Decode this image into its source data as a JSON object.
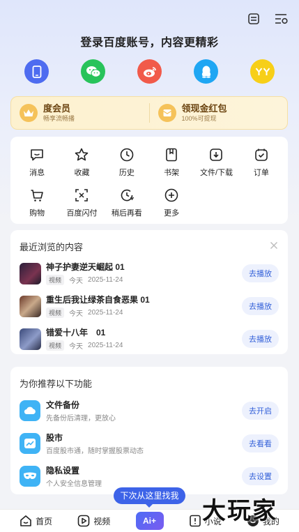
{
  "header": {
    "icons": [
      "menu-list-icon",
      "settings-list-icon"
    ],
    "login_prompt": "登录百度账号，内容更精彩",
    "login_options": [
      {
        "name": "phone",
        "color": "#4e6cf0"
      },
      {
        "name": "wechat",
        "color": "#28c35a"
      },
      {
        "name": "weibo",
        "color": "#f15a4a"
      },
      {
        "name": "qq",
        "color": "#1fa6f3"
      },
      {
        "name": "yy",
        "color": "#f7cf18"
      }
    ]
  },
  "vip": {
    "member_title": "度会员",
    "member_sub": "畅享流畅播",
    "redpacket_title": "领现金红包",
    "redpacket_sub": "100%可提现"
  },
  "tools": [
    {
      "label": "消息",
      "icon": "message-icon"
    },
    {
      "label": "收藏",
      "icon": "star-icon"
    },
    {
      "label": "历史",
      "icon": "clock-icon"
    },
    {
      "label": "书架",
      "icon": "bookmark-icon"
    },
    {
      "label": "文件/下载",
      "icon": "download-icon"
    },
    {
      "label": "订单",
      "icon": "order-icon"
    },
    {
      "label": "购物",
      "icon": "cart-icon"
    },
    {
      "label": "百度闪付",
      "icon": "scan-pay-icon"
    },
    {
      "label": "稍后再看",
      "icon": "watch-later-icon"
    },
    {
      "label": "更多",
      "icon": "plus-icon"
    }
  ],
  "recent": {
    "title": "最近浏览的内容",
    "items": [
      {
        "title": "神子护妻逆天崛起 01",
        "tag": "视频",
        "day": "今天",
        "date": "2025-11-24",
        "action": "去播放"
      },
      {
        "title": "重生后我让绿茶自食恶果 01",
        "tag": "视频",
        "day": "今天",
        "date": "2025-11-24",
        "action": "去播放"
      },
      {
        "title": "错爱十八年　01",
        "tag": "视频",
        "day": "今天",
        "date": "2025-11-24",
        "action": "去播放"
      }
    ]
  },
  "recommend": {
    "title": "为你推荐以下功能",
    "items": [
      {
        "title": "文件备份",
        "sub": "先备份后清理，更放心",
        "action": "去开启",
        "color": "#3fb3f5"
      },
      {
        "title": "股市",
        "sub": "百度股市通，随时掌握股票动态",
        "action": "去看看",
        "color": "#3fb3f5"
      },
      {
        "title": "隐私设置",
        "sub": "个人安全信息管理",
        "action": "去设置",
        "color": "#3fb3f5"
      }
    ]
  },
  "tooltip": "下次从这里找我",
  "nav": {
    "home": "首页",
    "video": "视频",
    "ai": "Ai+",
    "novel": "小说",
    "mine": "我的"
  },
  "watermark": "大玩家"
}
